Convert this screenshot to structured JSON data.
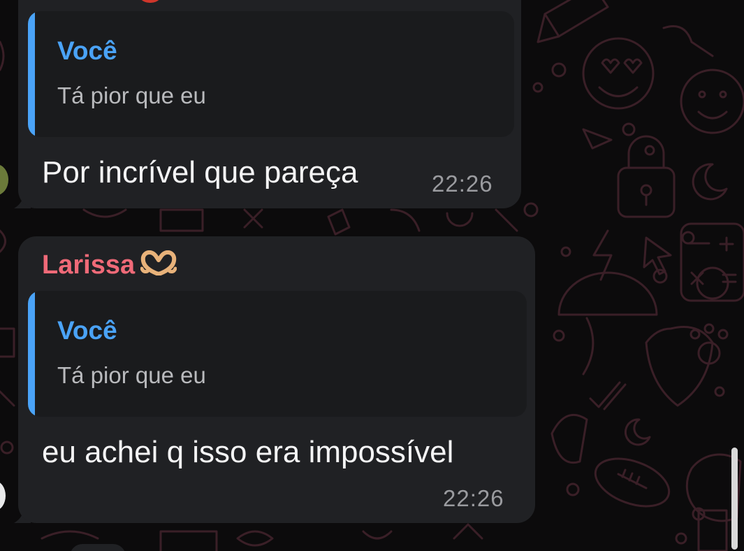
{
  "messages": [
    {
      "sender": "",
      "quote": {
        "author": "Você",
        "text": "Tá pior que eu"
      },
      "text": "Por incrível que pareça",
      "time": "22:26"
    },
    {
      "sender": "Larissa",
      "sender_emoji": "heart-hands-icon",
      "quote": {
        "author": "Você",
        "text": "Tá pior que eu"
      },
      "text": "eu achei q isso era impossível",
      "time": "22:26"
    }
  ],
  "colors": {
    "background": "#0c0b0c",
    "bubble": "#202124",
    "quote_bg": "#1a1b1d",
    "quote_accent": "#4aa3f7",
    "sender_name": "#f06a78",
    "text": "#f4f4f5",
    "time": "#9a9b9f"
  }
}
